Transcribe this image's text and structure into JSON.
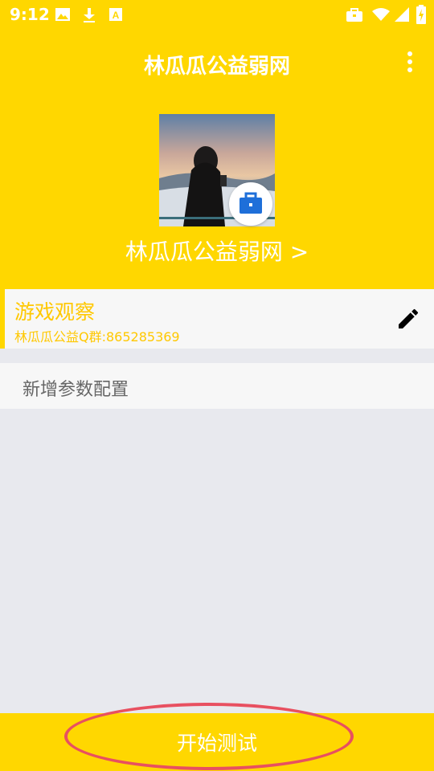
{
  "status_bar": {
    "time": "9:12",
    "icons": [
      "image-icon",
      "download-icon",
      "a-letter-icon",
      "briefcase-icon",
      "wifi-icon",
      "signal-icon",
      "battery-charging-icon"
    ]
  },
  "header": {
    "title": "林瓜瓜公益弱网",
    "profile_name": "林瓜瓜公益弱网 >"
  },
  "card": {
    "title": "游戏观察",
    "subtitle": "林瓜瓜公益Q群:865285369"
  },
  "add_config": {
    "label": "新增参数配置"
  },
  "bottom": {
    "start_label": "开始测试"
  },
  "colors": {
    "primary": "#FFD700",
    "accent_text": "#FFC800",
    "highlight_oval": "#E85060",
    "content_bg": "#E8E9EE"
  }
}
